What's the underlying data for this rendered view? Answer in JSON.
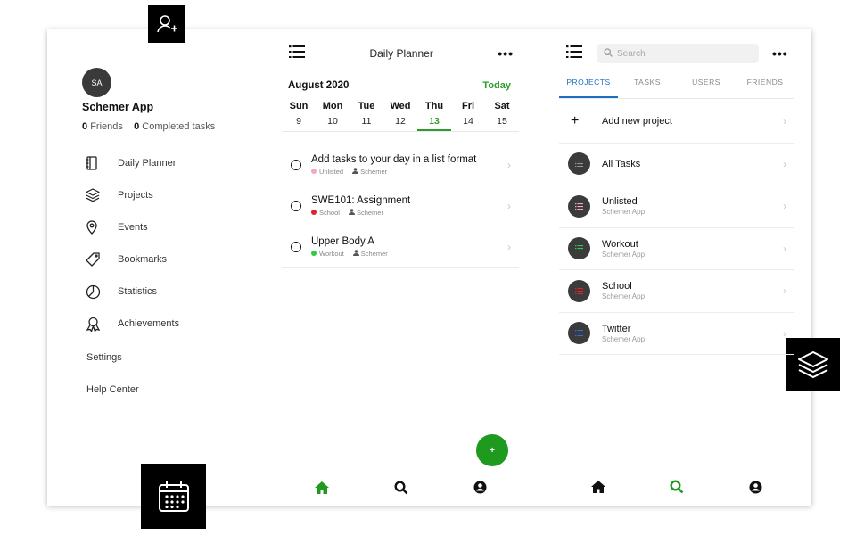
{
  "sidebar": {
    "avatar_initials": "SA",
    "app_name": "Schemer App",
    "friends_count": "0",
    "friends_label": "Friends",
    "completed_count": "0",
    "completed_label": "Completed tasks",
    "nav": [
      {
        "label": "Daily Planner",
        "icon": "planner-icon"
      },
      {
        "label": "Projects",
        "icon": "layers-icon"
      },
      {
        "label": "Events",
        "icon": "location-pin-icon"
      },
      {
        "label": "Bookmarks",
        "icon": "tag-icon"
      },
      {
        "label": "Statistics",
        "icon": "pie-chart-icon"
      },
      {
        "label": "Achievements",
        "icon": "award-icon"
      }
    ],
    "settings": "Settings",
    "help": "Help Center"
  },
  "planner": {
    "title": "Daily Planner",
    "month": "August 2020",
    "today": "Today",
    "days": [
      {
        "name": "Sun",
        "date": "9"
      },
      {
        "name": "Mon",
        "date": "10"
      },
      {
        "name": "Tue",
        "date": "11"
      },
      {
        "name": "Wed",
        "date": "12"
      },
      {
        "name": "Thu",
        "date": "13"
      },
      {
        "name": "Fri",
        "date": "14"
      },
      {
        "name": "Sat",
        "date": "15"
      }
    ],
    "active_day": "13",
    "tasks": [
      {
        "title": "Add tasks to your day in a list format",
        "project": "Unlisted",
        "color": "#f4a6c8",
        "owner": "Schemer"
      },
      {
        "title": "SWE101: Assignment",
        "project": "School",
        "color": "#e0222a",
        "owner": "Schemer"
      },
      {
        "title": "Upper Body A",
        "project": "Workout",
        "color": "#2ecc40",
        "owner": "Schemer"
      }
    ],
    "fab": "+"
  },
  "projects": {
    "search_placeholder": "Search",
    "tabs": [
      "PROJECTS",
      "TASKS",
      "USERS",
      "FRIENDS"
    ],
    "add_label": "Add new project",
    "list": [
      {
        "title": "All Tasks",
        "sub": "",
        "color": "#888888"
      },
      {
        "title": "Unlisted",
        "sub": "Schemer App",
        "color": "#f4a6c8"
      },
      {
        "title": "Workout",
        "sub": "Schemer App",
        "color": "#2ecc40"
      },
      {
        "title": "School",
        "sub": "Schemer App",
        "color": "#e0222a"
      },
      {
        "title": "Twitter",
        "sub": "Schemer App",
        "color": "#2f6fd6"
      }
    ]
  },
  "colors": {
    "accent_green": "#2a9d2a",
    "accent_blue": "#1f6fc0"
  }
}
